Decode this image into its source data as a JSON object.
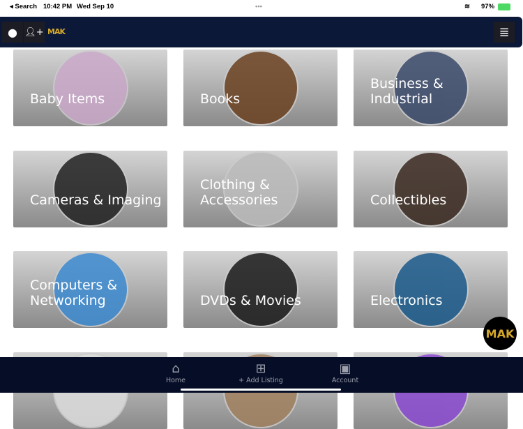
{
  "status": {
    "back": "◂ Search",
    "time": "10:42 PM",
    "date": "Wed Sep 10",
    "battery": "97%"
  },
  "header": {
    "logo": "MAK"
  },
  "categories": [
    {
      "label": "Baby Items",
      "color": "#c9a9c9"
    },
    {
      "label": "Books",
      "color": "#6a4020"
    },
    {
      "label": "Business & Industrial",
      "color": "#3a4a6a"
    },
    {
      "label": "Cameras & Imaging",
      "color": "#222"
    },
    {
      "label": "Clothing & Accessories",
      "color": "#bbb"
    },
    {
      "label": "Collectibles",
      "color": "#3a2a20"
    },
    {
      "label": "Computers & Networking",
      "color": "#3c8ad0"
    },
    {
      "label": "DVDs & Movies",
      "color": "#1a1a1a"
    },
    {
      "label": "Electronics",
      "color": "#1a5a8a"
    },
    {
      "label": "",
      "color": "#ddd"
    },
    {
      "label": "",
      "color": "#a08060"
    },
    {
      "label": "",
      "color": "#8a4ad0"
    }
  ],
  "bottom_nav": [
    {
      "label": "Home",
      "icon": "⌂"
    },
    {
      "label": "+ Add Listing",
      "icon": "⊞"
    },
    {
      "label": "Account",
      "icon": "▣"
    }
  ],
  "fab": {
    "logo": "MAK"
  }
}
